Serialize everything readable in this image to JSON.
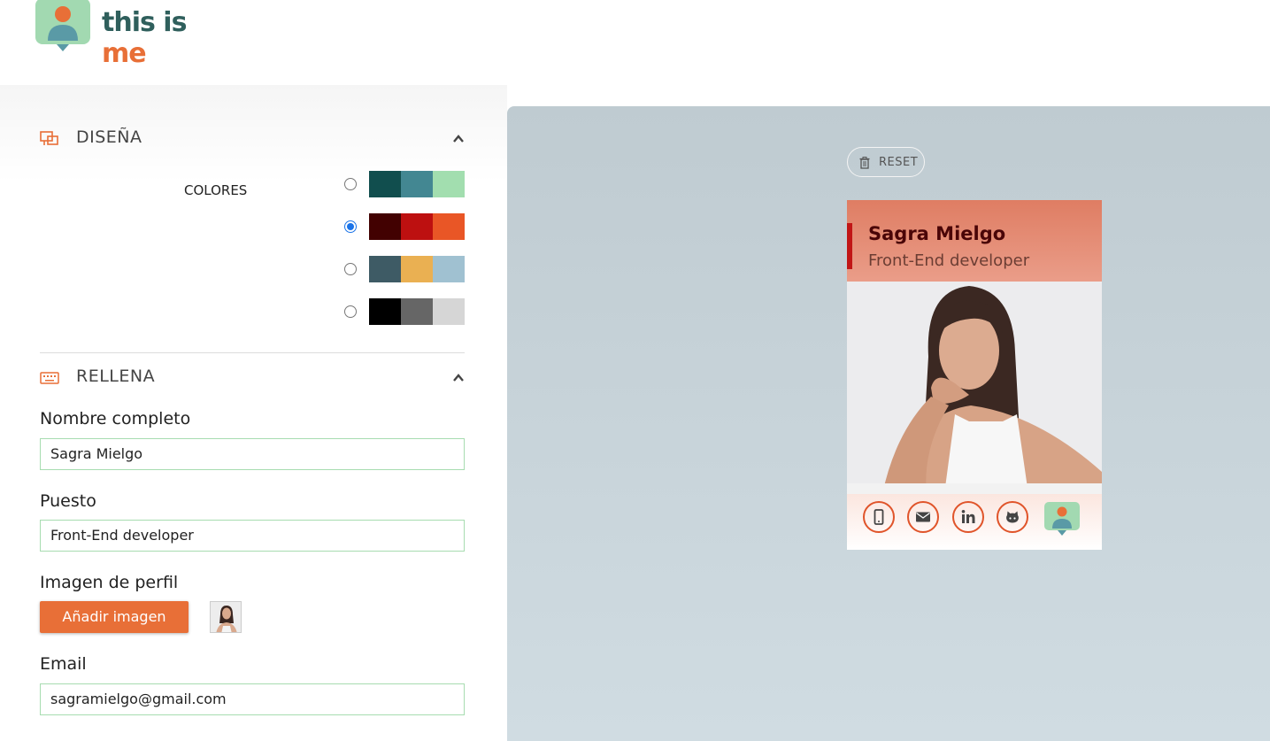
{
  "header": {
    "logo_text_1": "this is",
    "logo_text_2": "me"
  },
  "design": {
    "title": "DISEÑA",
    "colors_label": "COLORES",
    "palettes": [
      {
        "colors": [
          "#114e4e",
          "#438792",
          "#a2deaf"
        ],
        "selected": false
      },
      {
        "colors": [
          "#420101",
          "#bd1010",
          "#e95626"
        ],
        "selected": true
      },
      {
        "colors": [
          "#3e5b65",
          "#eab052",
          "#a0c1d1"
        ],
        "selected": false
      },
      {
        "colors": [
          "#000000",
          "#666666",
          "#d6d6d6"
        ],
        "selected": false
      }
    ]
  },
  "fill": {
    "title": "RELLENA",
    "name_label": "Nombre completo",
    "name_value": "Sagra Mielgo",
    "job_label": "Puesto",
    "job_value": "Front-End developer",
    "image_label": "Imagen de perfil",
    "add_image_label": "Añadir imagen",
    "email_label": "Email",
    "email_value": "sagramielgo@gmail.com"
  },
  "preview": {
    "reset_label": "RESET",
    "card_name": "Sagra Mielgo",
    "card_job": "Front-End developer",
    "icons": [
      "mobile-icon",
      "envelope-icon",
      "linkedin-icon",
      "github-icon"
    ]
  },
  "colors": {
    "accent": "#e86f37",
    "preview_bg": "#c8d5db",
    "card_icon_border": "#e0542a"
  }
}
